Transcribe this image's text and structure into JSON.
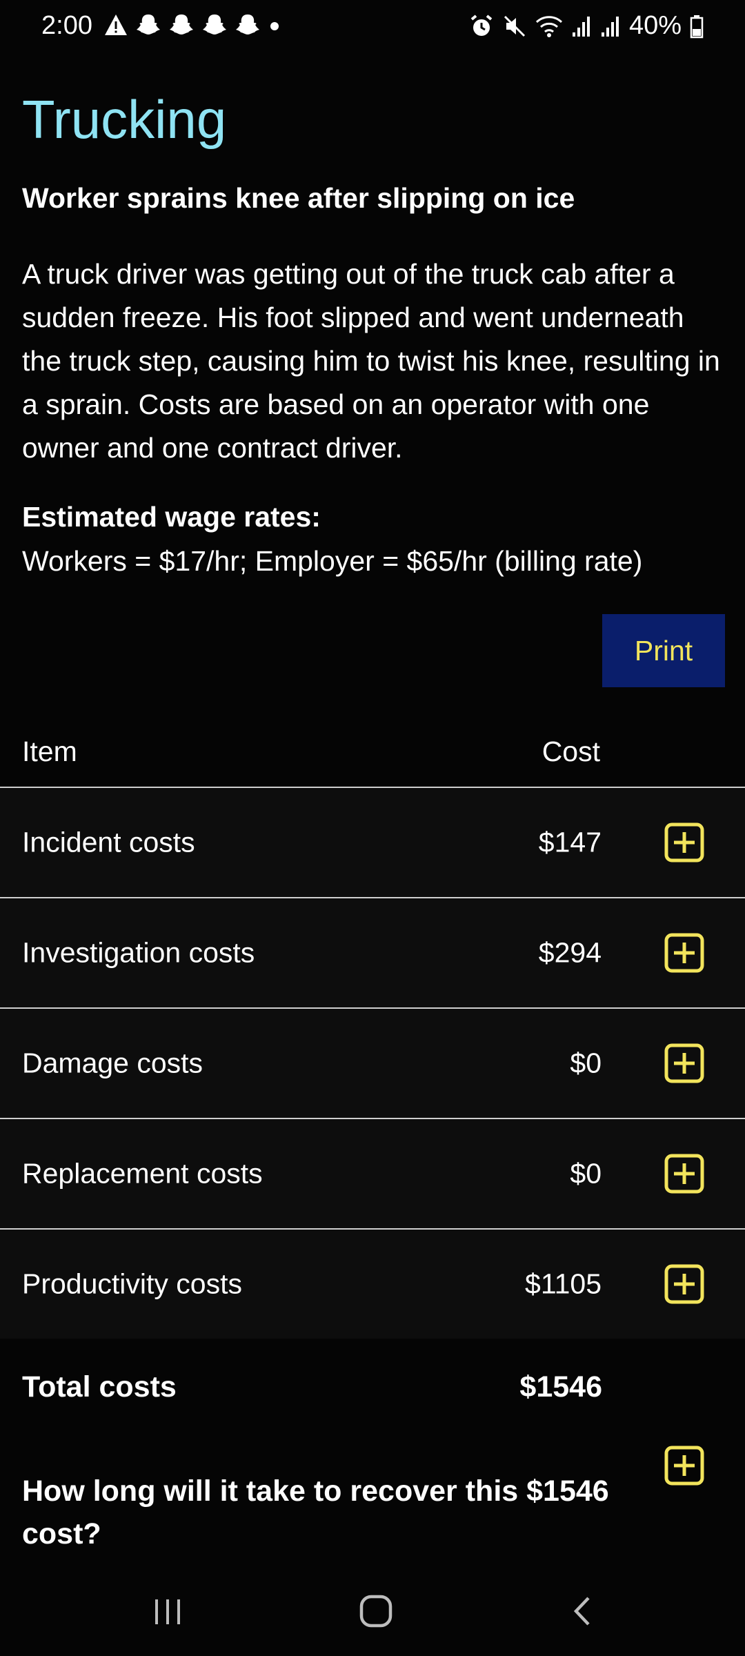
{
  "status_bar": {
    "time": "2:00",
    "battery": "40%",
    "left_icons": [
      "warning-icon",
      "snapchat-icon",
      "snapchat-icon",
      "snapchat-icon",
      "snapchat-icon",
      "dot-icon"
    ],
    "right_icons": [
      "alarm-icon",
      "mute-icon",
      "wifi-icon",
      "signal-icon",
      "signal-icon",
      "battery-icon"
    ]
  },
  "page": {
    "title": "Trucking",
    "subtitle": "Worker sprains knee after slipping on ice",
    "description": "A truck driver was getting out of the truck cab after a sudden freeze. His foot slipped and went underneath the truck step, causing him to twist his knee, resulting in a sprain. Costs are based on an operator with one owner and one contract driver.",
    "wage_heading": "Estimated wage rates:",
    "wage_text": "Workers = $17/hr; Employer = $65/hr (billing rate)",
    "print_label": "Print"
  },
  "table": {
    "headers": {
      "item": "Item",
      "cost": "Cost"
    },
    "rows": [
      {
        "label": "Incident costs",
        "cost": "$147"
      },
      {
        "label": "Investigation costs",
        "cost": "$294"
      },
      {
        "label": "Damage costs",
        "cost": "$0"
      },
      {
        "label": "Replacement costs",
        "cost": "$0"
      },
      {
        "label": "Productivity costs",
        "cost": "$1105"
      }
    ],
    "total_label": "Total costs",
    "total_value": "$1546"
  },
  "recover": {
    "question": "How long will it take to recover this $1546 cost?"
  },
  "colors": {
    "title": "#8fe3f3",
    "accent_yellow": "#f2e45c",
    "print_bg": "#0a1e6b",
    "background": "#050505"
  },
  "nav": [
    "recent-apps-icon",
    "home-icon",
    "back-icon"
  ]
}
